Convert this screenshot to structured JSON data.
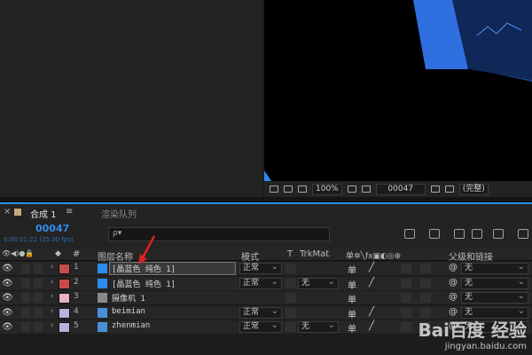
{
  "viewer": {
    "zoom": "100%",
    "time": "00047",
    "quality": "(完整)"
  },
  "tabs": {
    "comp_tab": "合成 1",
    "render_queue": "渲染队列",
    "menu_glyph": "≡",
    "close_glyph": "×"
  },
  "info": {
    "timecode": "00047",
    "fps_text": "0:00:01:22 (25.00 fps)",
    "search_glyph": "ρ▾"
  },
  "header": {
    "col_num": "#",
    "col_name": "图层名称",
    "col_mode": "模式",
    "col_t": "T",
    "col_trkmat": "TrkMat",
    "col_parent": "父级和链接"
  },
  "layers": [
    {
      "num": "1",
      "name": "[晶蓝色 纯色 1]",
      "color": "#c84b4b",
      "type_color": "#2d8ceb",
      "mode": "正常",
      "trkmat": "",
      "parent": "无",
      "sw1": "单"
    },
    {
      "num": "2",
      "name": "[晶蓝色 纯色 1]",
      "color": "#c84b4b",
      "type_color": "#2d8ceb",
      "mode": "正常",
      "trkmat": "无",
      "parent": "无",
      "sw1": "单"
    },
    {
      "num": "3",
      "name": "摄像机 1",
      "color": "#e8b4c0",
      "type_color": "#8a8a8a",
      "mode": "",
      "trkmat": "",
      "parent": "无",
      "sw1": "单"
    },
    {
      "num": "4",
      "name": "beimian",
      "color": "#b4b4dc",
      "type_color": "#4a90d9",
      "mode": "正常",
      "trkmat": "",
      "parent": "无",
      "sw1": "单"
    },
    {
      "num": "5",
      "name": "zhenmian",
      "color": "#b4b4dc",
      "type_color": "#4a90d9",
      "mode": "正常",
      "trkmat": "无",
      "parent": "无",
      "sw1": "单"
    }
  ],
  "watermark": {
    "line1": "Bai百度 经验",
    "line2": "jingyan.baidu.com"
  },
  "colors": {
    "accent": "#2d8ceb",
    "background": "#232323",
    "annotation": "#e02020"
  }
}
